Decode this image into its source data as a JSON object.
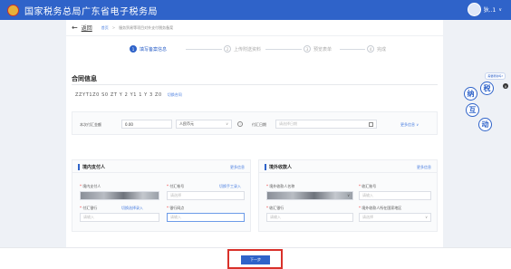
{
  "header": {
    "title": "国家税务总局广东省电子税务局",
    "user_name": "狄..1",
    "user_caret": "∨",
    "emblem_icon": "national-emblem-icon",
    "avatar_icon": "user-avatar-icon"
  },
  "breadcrumb": {
    "back_label": "返回",
    "home": "首页",
    "separator": ">",
    "current": "服务贸易等项目对外支付税务备案"
  },
  "steps": [
    {
      "num": "1",
      "label": "填写备案信息",
      "active": true
    },
    {
      "num": "2",
      "label": "上传附送资料",
      "active": false
    },
    {
      "num": "3",
      "label": "预览表单",
      "active": false
    },
    {
      "num": "4",
      "label": "完成",
      "active": false
    }
  ],
  "contract": {
    "section_title": "合同信息",
    "number": "ZZYT1Z0 S0 ZT Y 2 Y1 1 Y 3 Z0",
    "switch_link": "切换合同"
  },
  "amount_row": {
    "amount_label": "本次付汇金额",
    "amount_value": "0.00",
    "currency_value": "人民币元",
    "payment_date_label": "付汇日期",
    "payment_date_placeholder": "请选择日期",
    "more_link": "更多信息 ∨"
  },
  "payer_panel": {
    "title": "境内支付人",
    "more_link": "更多信息",
    "name_label": "境内支付人",
    "bank_no_label": "付汇帐号",
    "manual_link": "切换手工录入",
    "bank_no_placeholder": "请选择",
    "bank_label": "付汇银行",
    "bank_switch_link": "切换选择录入",
    "bank_placeholder": "请输入",
    "branch_label": "银行网点",
    "branch_placeholder": "请输入"
  },
  "payee_panel": {
    "title": "境外收款人",
    "more_link": "更多信息",
    "name_label": "境外收款人名称",
    "account_label": "收汇账号",
    "account_placeholder": "请输入",
    "bank_label": "收汇银行",
    "bank_placeholder": "请输入",
    "country_label": "境外收款人所在国家地区",
    "country_placeholder": "请选择"
  },
  "footer": {
    "next_label": "下一步"
  },
  "mascot": {
    "bubble": "需要帮助吗?",
    "chars": [
      "纳",
      "税",
      "互",
      "动"
    ],
    "close": "×"
  },
  "colors": {
    "brand": "#2f63c9",
    "highlight": "#d9312a"
  }
}
